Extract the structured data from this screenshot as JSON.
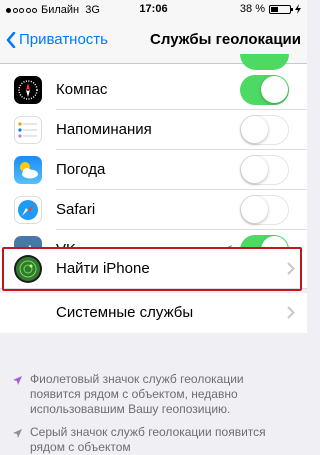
{
  "status_bar": {
    "carrier": "Билайн",
    "network": "3G",
    "time": "17:06",
    "battery": "38 %",
    "battery_level": 0.38
  },
  "nav": {
    "back_label": "Приватность",
    "title": "Службы геолокации"
  },
  "rows": [
    {
      "label": "Компас",
      "toggle": "on",
      "icon": "compass-icon"
    },
    {
      "label": "Напоминания",
      "toggle": "off",
      "icon": "reminders-icon"
    },
    {
      "label": "Погода",
      "toggle": "off",
      "icon": "weather-icon"
    },
    {
      "label": "Safari",
      "toggle": "off",
      "icon": "safari-icon"
    },
    {
      "label": "VK",
      "toggle": "on",
      "icon": "vk-icon"
    }
  ],
  "find_iphone": {
    "label": "Найти iPhone",
    "icon": "find-iphone-icon"
  },
  "system_services": {
    "label": "Системные службы"
  },
  "footer": {
    "purple_note": "Фиолетовый значок служб геолокации появится рядом с объектом, недавно использовавшим Вашу геопозицию.",
    "gray_note": "Серый значок служб геолокации появится рядом с объектом"
  },
  "colors": {
    "accent": "#007aff",
    "toggle_on": "#4cd964",
    "highlight": "#c0171b",
    "purple": "#a05de4"
  }
}
